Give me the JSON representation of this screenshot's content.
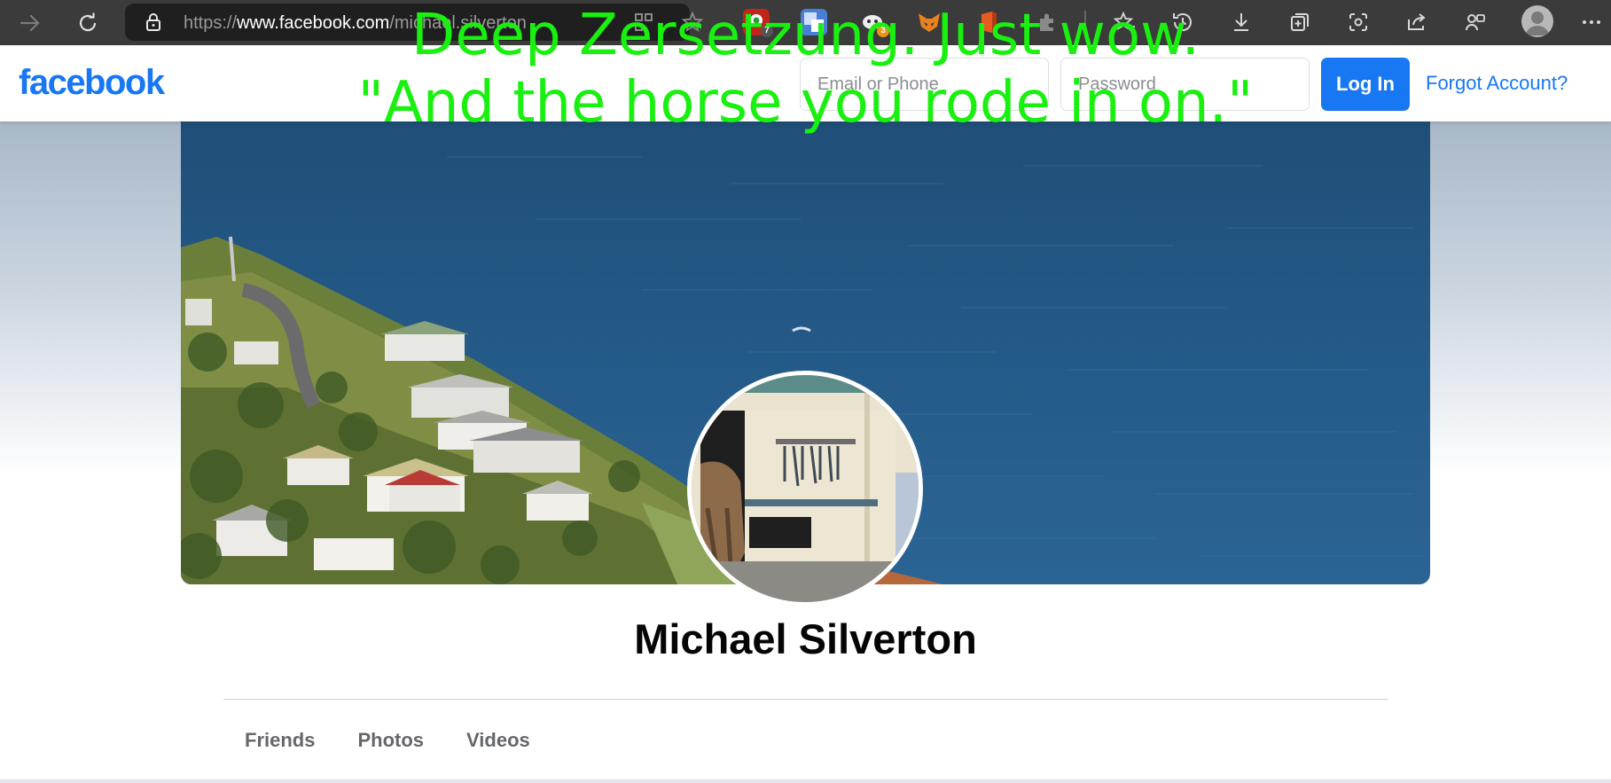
{
  "browser": {
    "url_prefix": "https://",
    "url_domain": "www.facebook.com",
    "url_path": "/michael.silverton",
    "extension_badges": {
      "first": "7",
      "second": "3"
    }
  },
  "header": {
    "logo": "facebook",
    "email_placeholder": "Email or Phone",
    "password_placeholder": "Password",
    "login_label": "Log In",
    "forgot_label": "Forgot Account?"
  },
  "profile": {
    "name": "Michael Silverton",
    "tabs": [
      "Friends",
      "Photos",
      "Videos"
    ]
  },
  "overlay": {
    "line1": "Deep Zersetzung. Just wow.",
    "line2": "\"And the horse you rode in on.\""
  },
  "colors": {
    "brand": "#1877f2",
    "overlay_text": "#19f00f",
    "browser_bar": "#3b3b3b"
  }
}
